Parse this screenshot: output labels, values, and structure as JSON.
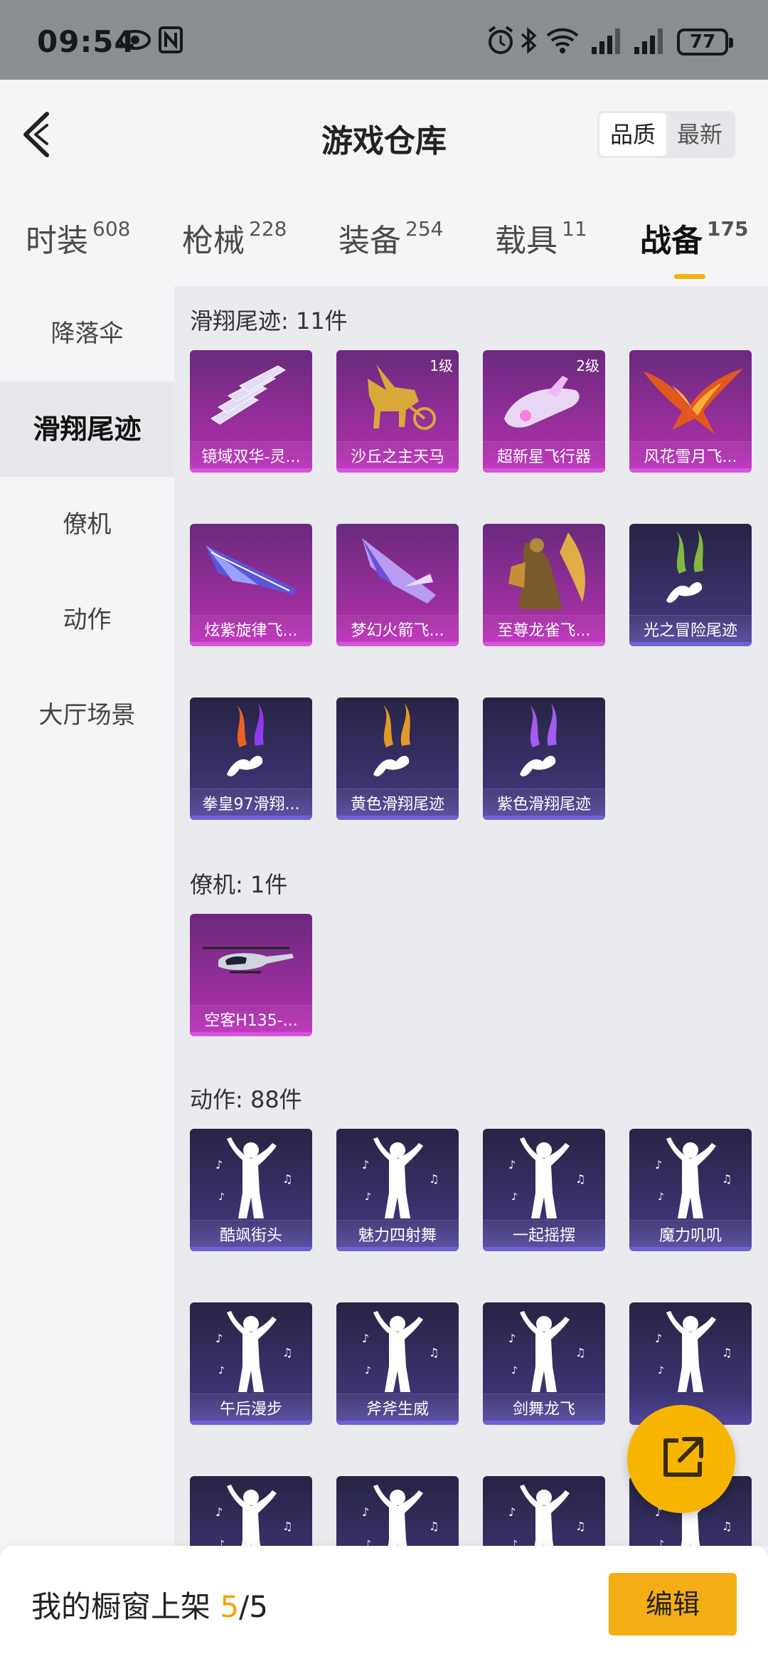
{
  "status_bar": {
    "time": "09:54",
    "battery": "77"
  },
  "header": {
    "title": "游戏仓库",
    "sort": [
      "品质",
      "最新"
    ],
    "sort_active": 0
  },
  "tabs": [
    {
      "label": "时装",
      "count": "608"
    },
    {
      "label": "枪械",
      "count": "228"
    },
    {
      "label": "装备",
      "count": "254"
    },
    {
      "label": "载具",
      "count": "11"
    },
    {
      "label": "战备",
      "count": "175"
    }
  ],
  "active_tab": 4,
  "sidebar": [
    "降落伞",
    "滑翔尾迹",
    "僚机",
    "动作",
    "大厅场景"
  ],
  "active_sidebar": 1,
  "sections": [
    {
      "title": "滑翔尾迹: 11件",
      "items": [
        {
          "name": "镜域双华-灵...",
          "rarity": "purple",
          "level": "",
          "icon": "crystal-wings-icon"
        },
        {
          "name": "沙丘之主天马",
          "rarity": "purple",
          "level": "1级",
          "icon": "golden-pegasus-icon"
        },
        {
          "name": "超新星飞行器",
          "rarity": "purple",
          "level": "2级",
          "icon": "supernova-craft-icon"
        },
        {
          "name": "风花雪月飞...",
          "rarity": "purple",
          "level": "",
          "icon": "phoenix-icon"
        },
        {
          "name": "炫紫旋律飞...",
          "rarity": "purple",
          "level": "",
          "icon": "purple-glider-icon"
        },
        {
          "name": "梦幻火箭飞...",
          "rarity": "purple",
          "level": "",
          "icon": "dream-rocket-icon"
        },
        {
          "name": "至尊龙雀飞...",
          "rarity": "purple",
          "level": "",
          "icon": "dragon-bird-icon"
        },
        {
          "name": "光之冒险尾迹",
          "rarity": "blue",
          "level": "",
          "icon": "green-smoke-trail-icon"
        },
        {
          "name": "拳皇97滑翔...",
          "rarity": "blue",
          "level": "",
          "icon": "fire-smoke-trail-icon"
        },
        {
          "name": "黄色滑翔尾迹",
          "rarity": "blue",
          "level": "",
          "icon": "yellow-smoke-trail-icon"
        },
        {
          "name": "紫色滑翔尾迹",
          "rarity": "blue",
          "level": "",
          "icon": "purple-smoke-trail-icon"
        }
      ]
    },
    {
      "title": "僚机: 1件",
      "items": [
        {
          "name": "空客H135-...",
          "rarity": "purple",
          "level": "",
          "icon": "helicopter-icon"
        }
      ]
    },
    {
      "title": "动作: 88件",
      "items": [
        {
          "name": "酷飒街头",
          "rarity": "blue",
          "level": "",
          "icon": "dance-pose-icon"
        },
        {
          "name": "魅力四射舞",
          "rarity": "blue",
          "level": "",
          "icon": "dance-pose-icon"
        },
        {
          "name": "一起摇摆",
          "rarity": "blue",
          "level": "",
          "icon": "dance-pose-icon"
        },
        {
          "name": "魔力叽叽",
          "rarity": "blue",
          "level": "",
          "icon": "dance-pose-icon"
        },
        {
          "name": "午后漫步",
          "rarity": "blue",
          "level": "",
          "icon": "dance-pose-icon"
        },
        {
          "name": "斧斧生威",
          "rarity": "blue",
          "level": "",
          "icon": "dance-pose-icon"
        },
        {
          "name": "剑舞龙飞",
          "rarity": "blue",
          "level": "",
          "icon": "dance-pose-icon"
        },
        {
          "name": "",
          "rarity": "blue",
          "level": "",
          "icon": "dance-pose-icon"
        },
        {
          "name": "",
          "rarity": "blue",
          "level": "",
          "icon": "dance-pose-icon"
        },
        {
          "name": "",
          "rarity": "blue",
          "level": "",
          "icon": "dance-pose-icon"
        },
        {
          "name": "",
          "rarity": "blue",
          "level": "",
          "icon": "dance-pose-icon"
        },
        {
          "name": "",
          "rarity": "blue",
          "level": "",
          "icon": "dance-pose-icon"
        }
      ]
    }
  ],
  "bottom": {
    "prefix": "我的橱窗上架 ",
    "count": "5",
    "suffix": "/5",
    "edit_label": "编辑"
  },
  "colors": {
    "accent": "#f4ad15",
    "purple_card": "#a52fa5",
    "blue_card": "#3c3473"
  }
}
